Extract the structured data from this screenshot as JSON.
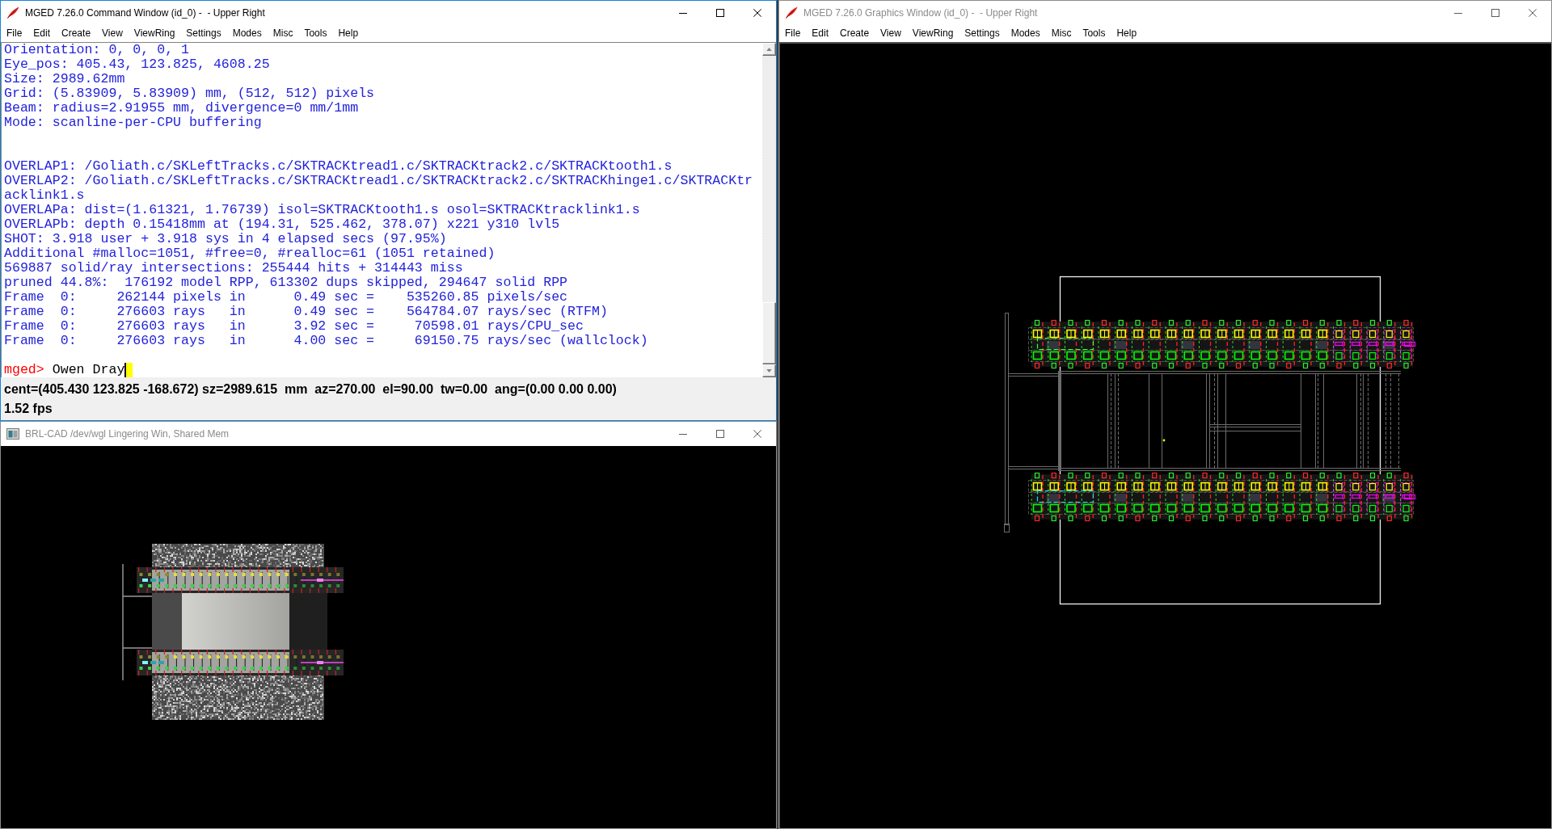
{
  "command_window": {
    "title": "MGED 7.26.0 Command Window (id_0) -  - Upper Right",
    "active": true,
    "menu": [
      "File",
      "Edit",
      "Create",
      "View",
      "ViewRing",
      "Settings",
      "Modes",
      "Misc",
      "Tools",
      "Help"
    ],
    "console": {
      "blocks": [
        [
          "Orientation: 0, 0, 0, 1",
          "Eye_pos: 405.43, 123.825, 4608.25",
          "Size: 2989.62mm",
          "Grid: (5.83909, 5.83909) mm, (512, 512) pixels",
          "Beam: radius=2.91955 mm, divergence=0 mm/1mm",
          "Mode: scanline-per-CPU buffering"
        ],
        [
          "OVERLAP1: /Goliath.c/SKLeftTracks.c/SKTRACKtread1.c/SKTRACKtrack2.c/SKTRACKtooth1.s",
          "OVERLAP2: /Goliath.c/SKLeftTracks.c/SKTRACKtread1.c/SKTRACKtrack2.c/SKTRACKhinge1.c/SKTRACKtracklink1.s",
          "OVERLAPa: dist=(1.61321, 1.76739) isol=SKTRACKtooth1.s osol=SKTRACKtracklink1.s",
          "OVERLAPb: depth 0.15418mm at (194.31, 525.462, 378.07) x221 y310 lvl5",
          "SHOT: 3.918 user + 3.918 sys in 4 elapsed secs (97.95%)",
          "Additional #malloc=1051, #free=0, #realloc=61 (1051 retained)",
          "569887 solid/ray intersections: 255444 hits + 314443 miss",
          "pruned 44.8%:  176192 model RPP, 613302 dups skipped, 294647 solid RPP",
          "Frame  0:     262144 pixels in      0.49 sec =    535260.85 pixels/sec",
          "Frame  0:     276603 rays   in      0.49 sec =    564784.07 rays/sec (RTFM)",
          "Frame  0:     276603 rays   in      3.92 sec =     70598.01 rays/CPU_sec",
          "Frame  0:     276603 rays   in      4.00 sec =     69150.75 rays/sec (wallclock)"
        ]
      ],
      "prompt": "mged>",
      "input": "Owen Dray"
    },
    "status_line": "cent=(405.430 123.825 -168.672) sz=2989.615  mm  az=270.00  el=90.00  tw=0.00  ang=(0.00 0.00 0.00)",
    "fps": "1.52 fps"
  },
  "graphics_window": {
    "title": "MGED 7.26.0 Graphics Window (id_0) -  - Upper Right",
    "active": false,
    "menu": [
      "File",
      "Edit",
      "Create",
      "View",
      "ViewRing",
      "Settings",
      "Modes",
      "Misc",
      "Tools",
      "Help"
    ]
  },
  "render_window": {
    "title": "BRL-CAD /dev/wgl Lingering Win, Shared Mem",
    "active": false
  }
}
